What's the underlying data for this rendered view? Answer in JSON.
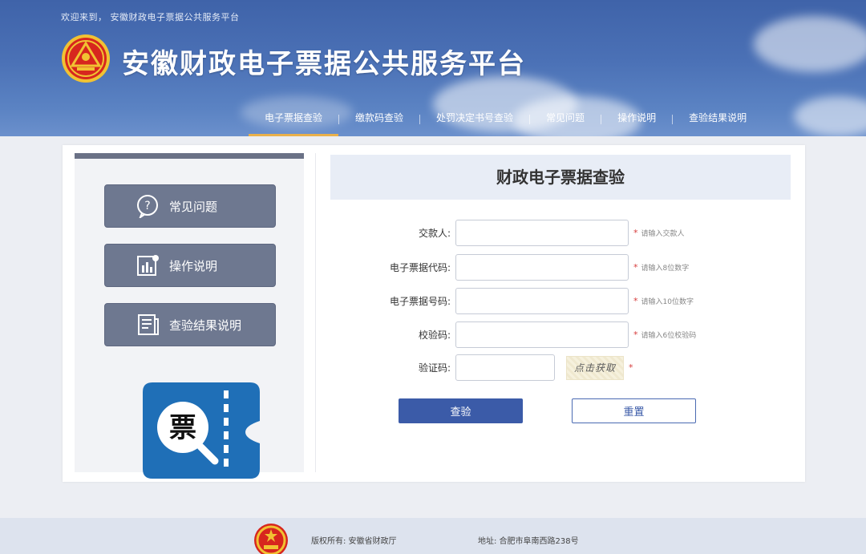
{
  "header": {
    "welcome": "欢迎来到，  安徽财政电子票据公共服务平台",
    "site_title": "安徽财政电子票据公共服务平台",
    "emblem_icon": "party-emblem-icon",
    "accent_color": "#e9b04b"
  },
  "nav": {
    "items": [
      {
        "label": "电子票据查验",
        "active": true
      },
      {
        "label": "缴款码查验",
        "active": false
      },
      {
        "label": "处罚决定书号查验",
        "active": false
      },
      {
        "label": "常见问题",
        "active": false
      },
      {
        "label": "操作说明",
        "active": false
      },
      {
        "label": "查验结果说明",
        "active": false
      }
    ]
  },
  "sidebar": {
    "items": [
      {
        "label": "常见问题",
        "icon": "question-bubble-icon"
      },
      {
        "label": "操作说明",
        "icon": "chart-document-icon"
      },
      {
        "label": "查验结果说明",
        "icon": "document-list-icon"
      }
    ],
    "logo_text": "票",
    "logo_icon": "ticket-search-icon",
    "logo_color": "#1f6fb7"
  },
  "form": {
    "title": "财政电子票据查验",
    "fields": [
      {
        "label": "交款人:",
        "value": "",
        "required": "*",
        "hint": "请输入交款人"
      },
      {
        "label": "电子票据代码:",
        "value": "",
        "required": "*",
        "hint": "请输入8位数字"
      },
      {
        "label": "电子票据号码:",
        "value": "",
        "required": "*",
        "hint": "请输入10位数字"
      },
      {
        "label": "校验码:",
        "value": "",
        "required": "*",
        "hint": "请输入6位校验码"
      },
      {
        "label": "验证码:",
        "value": "",
        "required": "*",
        "hint": ""
      }
    ],
    "captcha_text": "点击获取",
    "submit_label": "查验",
    "reset_label": "重置",
    "primary_color": "#3b5ba8"
  },
  "footer": {
    "copyright": "版权所有: 安徽省财政厅",
    "address": "地址: 合肥市阜南西路238号",
    "emblem_icon": "national-emblem-icon"
  }
}
